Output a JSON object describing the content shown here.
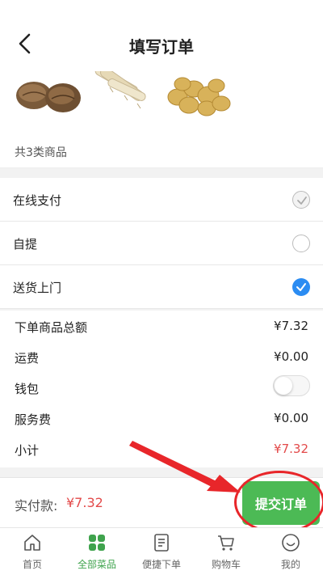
{
  "header": {
    "title": "填写订单"
  },
  "products": {
    "count_label": "共3类商品",
    "items": [
      "taro",
      "yam",
      "potato"
    ]
  },
  "options": [
    {
      "label": "在线支付",
      "state": "disabled-checked"
    },
    {
      "label": "自提",
      "state": "unchecked"
    },
    {
      "label": "送货上门",
      "state": "checked"
    }
  ],
  "summary": {
    "rows": [
      {
        "label": "下单商品总额",
        "value": "¥7.32"
      },
      {
        "label": "运费",
        "value": "¥0.00"
      },
      {
        "label": "钱包",
        "toggle": false
      },
      {
        "label": "服务费",
        "value": "¥0.00"
      },
      {
        "label": "小计",
        "value": "¥7.32"
      }
    ]
  },
  "paybar": {
    "label": "实付款:",
    "amount": "¥7.32",
    "submit_label": "提交订单"
  },
  "tabs": [
    {
      "label": "首页",
      "icon": "home-icon"
    },
    {
      "label": "全部菜品",
      "icon": "grid-icon",
      "active": true
    },
    {
      "label": "便捷下单",
      "icon": "list-icon"
    },
    {
      "label": "购物车",
      "icon": "cart-icon"
    },
    {
      "label": "我的",
      "icon": "smile-icon"
    }
  ],
  "colors": {
    "accent": "#4cba55",
    "price": "#e34a4a",
    "check": "#2b8cf2",
    "annotation": "#e8262a"
  }
}
